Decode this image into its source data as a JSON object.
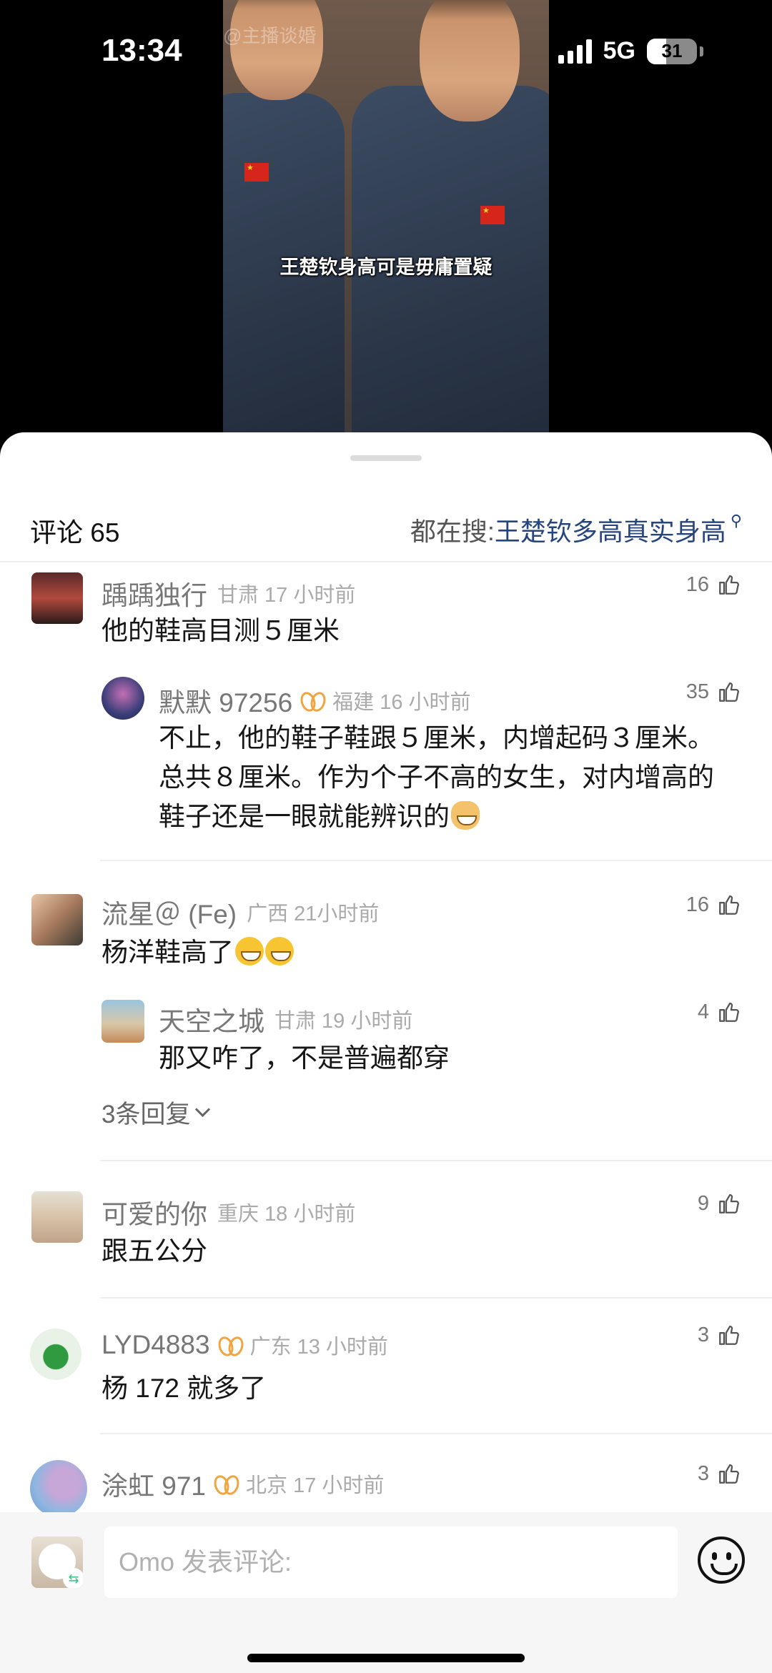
{
  "status": {
    "time": "13:34",
    "network": "5G",
    "battery": "31"
  },
  "video": {
    "watermark": "@主播谈婚",
    "caption": "王楚钦身高可是毋庸置疑"
  },
  "header": {
    "comment_count": "评论 65",
    "search_prefix": "都在搜: ",
    "search_keyword": "王楚钦多高真实身高"
  },
  "comments": [
    {
      "user": "踽踽独行",
      "location": "甘肃 17 小时前",
      "likes": "16",
      "text": "他的鞋高目测５厘米"
    },
    {
      "user": "默默 97256",
      "location": "福建 16 小时前",
      "likes": "35",
      "text_lines": [
        "不止，他的鞋子鞋跟５厘米，内增起码３厘米。",
        "总共８厘米。作为个子不高的女生，对内增高的",
        "鞋子还是一眼就能辨识的"
      ]
    },
    {
      "user": "流星＠ (Fe)",
      "location": "广西 21小时前",
      "likes": "16",
      "text": "杨洋鞋高了"
    },
    {
      "user": "天空之城",
      "location": "甘肃 19 小时前",
      "likes": "4",
      "text": "那又咋了，不是普遍都穿"
    },
    {
      "user": "可爱的你",
      "location": "重庆 18 小时前",
      "likes": "9",
      "text": "跟五公分"
    },
    {
      "user": "LYD4883",
      "location": "广东 13 小时前",
      "likes": "3",
      "text": "杨 172 就多了"
    },
    {
      "user": "涂虹 971",
      "location": "北京 17 小时前",
      "likes": "3"
    }
  ],
  "replies_label": "3条回复",
  "input": {
    "placeholder": "Omo 发表评论:"
  }
}
